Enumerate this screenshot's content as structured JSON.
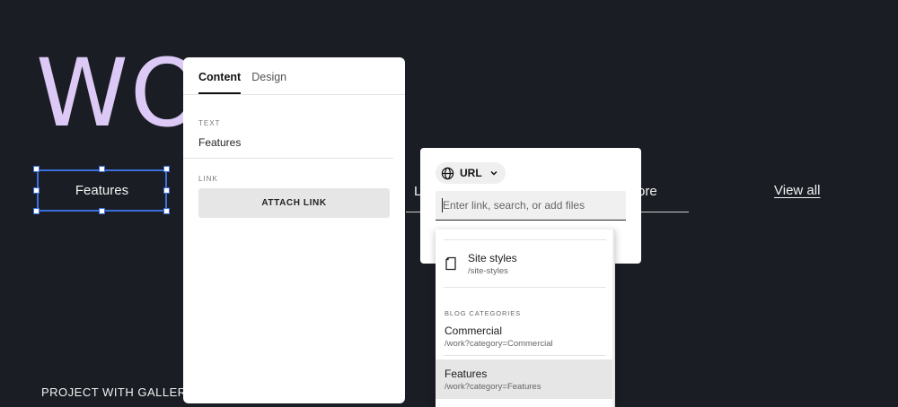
{
  "page": {
    "hero_title": "WO",
    "filters": {
      "selected": "Features",
      "partial_left": "L",
      "partial_right": "ore",
      "view_all": "View all"
    },
    "project_label": "PROJECT WITH GALLERY"
  },
  "panel": {
    "tabs": [
      {
        "label": "Content",
        "active": true
      },
      {
        "label": "Design",
        "active": false
      }
    ],
    "text_section_label": "TEXT",
    "text_value": "Features",
    "link_section_label": "LINK",
    "attach_button": "ATTACH LINK"
  },
  "link_popover": {
    "type_label": "URL",
    "search_placeholder": "Enter link, search, or add files"
  },
  "dropdown": {
    "pages": [
      {
        "title": "Site styles",
        "path": "/site-styles",
        "icon": "page-icon"
      }
    ],
    "category_heading": "BLOG CATEGORIES",
    "categories": [
      {
        "title": "Commercial",
        "path": "/work?category=Commercial"
      },
      {
        "title": "Features",
        "path": "/work?category=Features"
      }
    ]
  },
  "colors": {
    "background": "#1a1d24",
    "hero": "#dcc9f5",
    "selection": "#3a6fdc"
  }
}
